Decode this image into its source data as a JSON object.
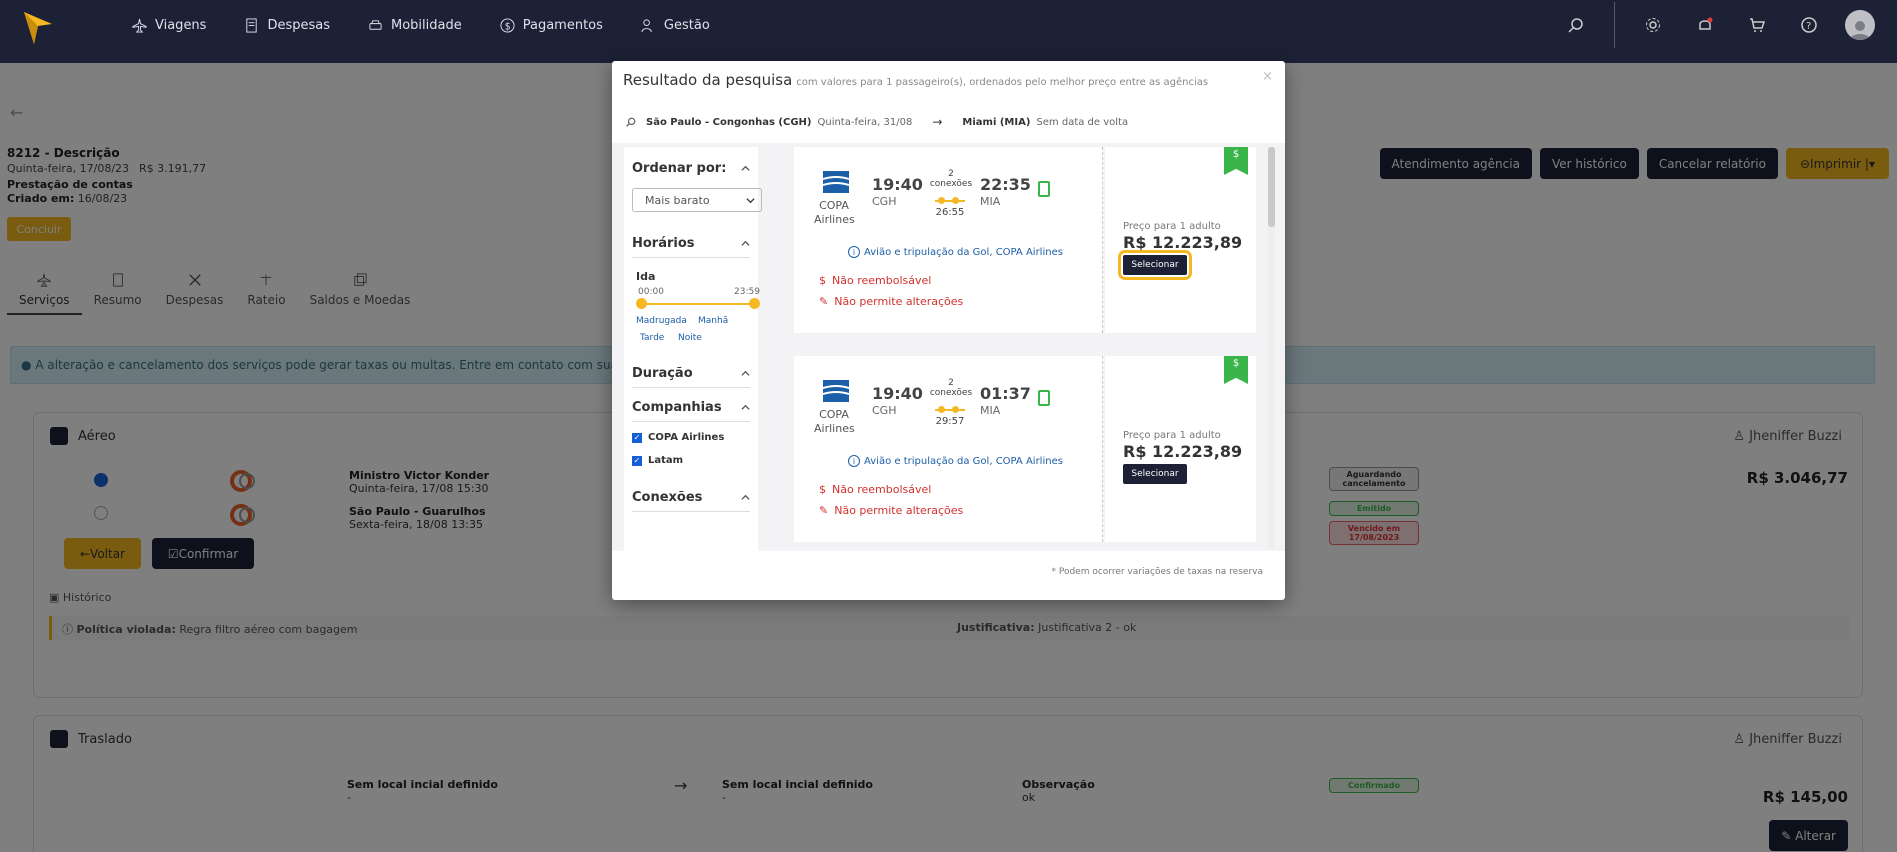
{
  "nav": {
    "items": [
      {
        "label": "Viagens",
        "icon": "plane-icon"
      },
      {
        "label": "Despesas",
        "icon": "receipt-icon"
      },
      {
        "label": "Mobilidade",
        "icon": "car-icon"
      },
      {
        "label": "Pagamentos",
        "icon": "dollar-icon"
      },
      {
        "label": "Gestão",
        "icon": "users-icon"
      }
    ]
  },
  "report": {
    "title": "8212 - Descrição",
    "date": "Quinta-feira, 17/08/23",
    "total": "R$ 3.191,77",
    "prestacao": "Prestação de contas",
    "created_label": "Criado em:",
    "created_value": "16/08/23",
    "conclude_label": "Concluir"
  },
  "tabs": [
    "Serviços",
    "Resumo",
    "Despesas",
    "Rateio",
    "Saldos e Moedas"
  ],
  "actions": {
    "agency": "Atendimento agência",
    "history": "Ver histórico",
    "cancel": "Cancelar relatório",
    "print": "Imprimir"
  },
  "info": "A alteração e cancelamento dos serviços pode gerar taxas ou multas. Entre em contato com sua agência pa",
  "aereo": {
    "title": "Aéreo",
    "user": "Jheniffer Buzzi",
    "trip1_name": "Ministro Victor Konder",
    "trip1_date": "Quinta-feira, 17/08 15:30",
    "trip2_name": "São Paulo - Guarulhos",
    "trip2_date": "Sexta-feira, 18/08 13:35",
    "badge1": "Aguardando cancelamento",
    "badge2": "Emitido",
    "badge3": "Vencido em 17/08/2023",
    "price": "R$ 3.046,77",
    "back_label": "Voltar",
    "confirm_label": "Confirmar",
    "history_label": "Histórico",
    "policy_label": "Política violada:",
    "policy_text": "Regra filtro aéreo com bagagem",
    "justif_label": "Justificativa:",
    "justif_text": "Justificativa 2 - ok"
  },
  "traslado": {
    "title": "Traslado",
    "user": "Jheniffer Buzzi",
    "origin_label": "Sem local incial definido",
    "origin_value": "-",
    "dest_label": "Sem local incial definido",
    "dest_value": "-",
    "obs_label": "Observação",
    "obs_value": "ok",
    "status": "Confirmado",
    "price": "R$ 145,00",
    "alter_label": "Alterar"
  },
  "modal": {
    "title": "Resultado da pesquisa",
    "subtitle": "com valores para 1 passageiro(s), ordenados pelo melhor preço entre as agências",
    "close": "×",
    "origin": "São Paulo - Congonhas (CGH)",
    "origin_date": "Quinta-feira, 31/08",
    "arrow": "→",
    "dest": "Miami (MIA)",
    "dest_date": "Sem data de volta",
    "footer": "* Podem ocorrer variações de taxas na reserva",
    "filters": {
      "order_label": "Ordenar por:",
      "order_value": "Mais barato",
      "schedule_label": "Horários",
      "ida_label": "Ida",
      "time_min": "00:00",
      "time_max": "23:59",
      "periods": [
        "Madrugada",
        "Manhã",
        "Tarde",
        "Noite"
      ],
      "duration_label": "Duração",
      "companies_label": "Companhias",
      "companies": [
        "COPA Airlines",
        "Latam"
      ],
      "connections_label": "Conexões"
    },
    "results": [
      {
        "airline": "COPA Airlines",
        "dep_time": "19:40",
        "dep_airport": "CGH",
        "arr_time": "22:35",
        "arr_airport": "MIA",
        "stops": "2 conexões",
        "duration": "26:55",
        "operated": "Avião e tripulação da Gol, COPA Airlines",
        "refund": "Não reembolsável",
        "changes": "Não permite alterações",
        "price_label": "Preço para 1 adulto",
        "price": "R$ 12.223,89",
        "select_label": "Selecionar",
        "ribbon": "$"
      },
      {
        "airline": "COPA Airlines",
        "dep_time": "19:40",
        "dep_airport": "CGH",
        "arr_time": "01:37",
        "arr_airport": "MIA",
        "stops": "2 conexões",
        "duration": "29:57",
        "operated": "Avião e tripulação da Gol, COPA Airlines",
        "refund": "Não reembolsável",
        "changes": "Não permite alterações",
        "price_label": "Preço para 1 adulto",
        "price": "R$ 12.223,89",
        "select_label": "Selecionar",
        "ribbon": "$"
      }
    ]
  }
}
